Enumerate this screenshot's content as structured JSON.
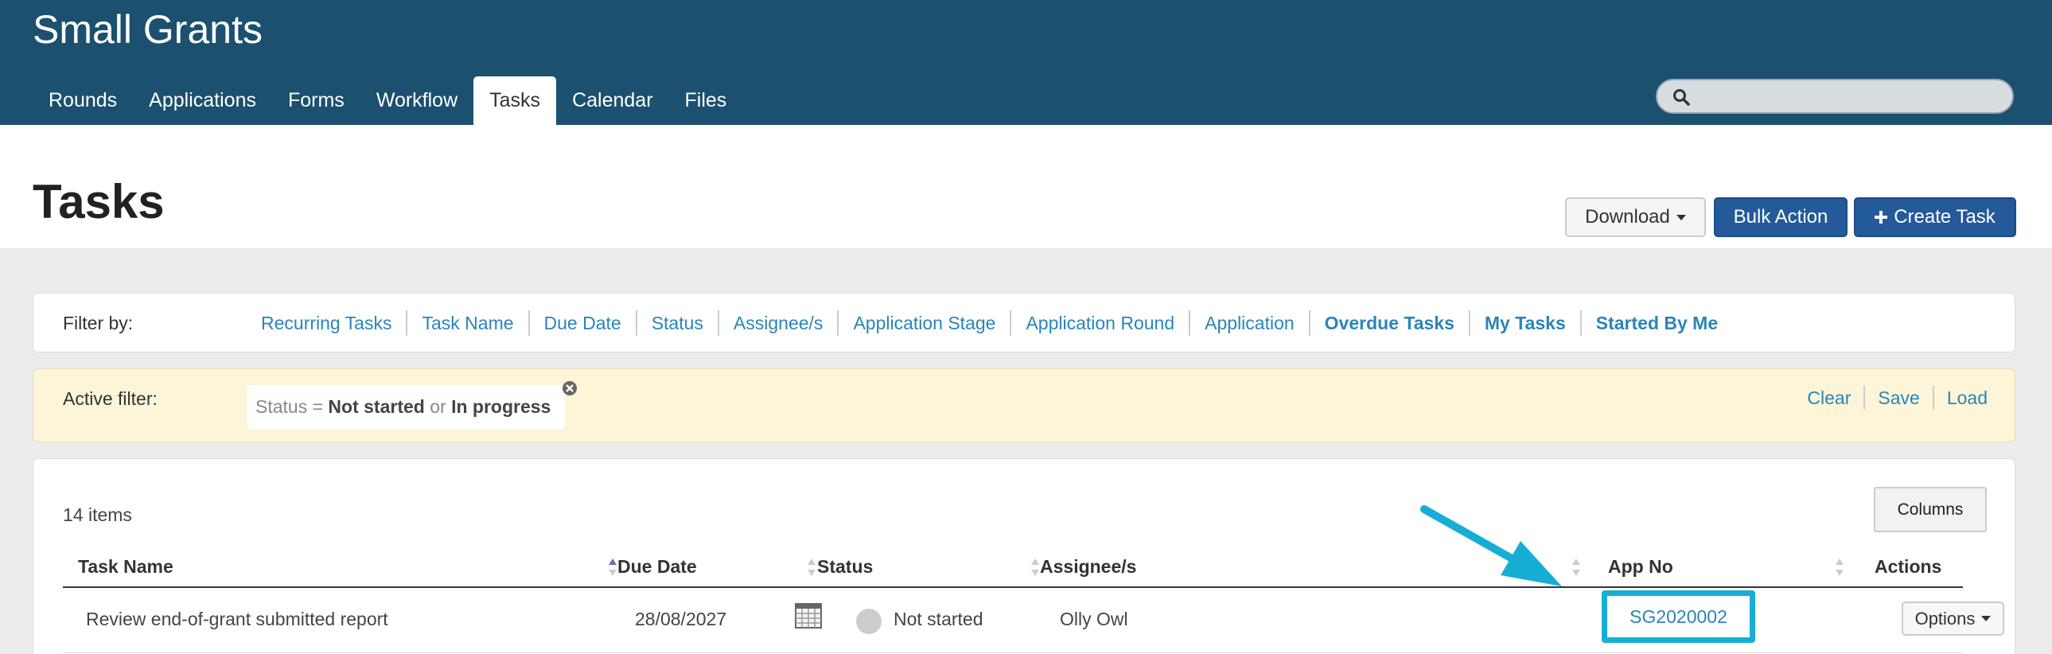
{
  "app_title": "Small Grants",
  "nav": {
    "items": [
      {
        "label": "Rounds"
      },
      {
        "label": "Applications"
      },
      {
        "label": "Forms"
      },
      {
        "label": "Workflow"
      },
      {
        "label": "Tasks"
      },
      {
        "label": "Calendar"
      },
      {
        "label": "Files"
      }
    ],
    "active": "Tasks"
  },
  "search": {
    "placeholder": ""
  },
  "page": {
    "title": "Tasks"
  },
  "toolbar": {
    "download_label": "Download",
    "bulk_action_label": "Bulk Action",
    "create_task_label": "Create Task"
  },
  "filter": {
    "label": "Filter by:",
    "links": [
      {
        "label": "Recurring Tasks"
      },
      {
        "label": "Task Name"
      },
      {
        "label": "Due Date"
      },
      {
        "label": "Status"
      },
      {
        "label": "Assignee/s"
      },
      {
        "label": "Application Stage"
      },
      {
        "label": "Application Round"
      },
      {
        "label": "Application"
      },
      {
        "label": "Overdue Tasks"
      },
      {
        "label": "My Tasks"
      },
      {
        "label": "Started By Me"
      }
    ]
  },
  "active_filter": {
    "label": "Active filter:",
    "chip": {
      "prefix": "Status = ",
      "value1": "Not started",
      "joiner": " or ",
      "value2": "In progress"
    },
    "actions": [
      {
        "label": "Clear"
      },
      {
        "label": "Save"
      },
      {
        "label": "Load"
      }
    ]
  },
  "table": {
    "count_text": "14 items",
    "columns_button": "Columns",
    "headers": {
      "task_name": "Task Name",
      "due_date": "Due Date",
      "status": "Status",
      "assignees": "Assignee/s",
      "app_no": "App No",
      "actions": "Actions"
    },
    "rows": [
      {
        "task_name": "Review end-of-grant submitted report",
        "due_date": "28/08/2027",
        "status": "Not started",
        "assignee": "Olly Owl",
        "app_no": "SG2020002",
        "options_label": "Options"
      }
    ]
  },
  "colors": {
    "header_bg": "#1b506f",
    "primary_button": "#245a9a",
    "link": "#2a85b7",
    "highlight": "#17aed6",
    "active_filter_bg": "#fcf5d8"
  }
}
